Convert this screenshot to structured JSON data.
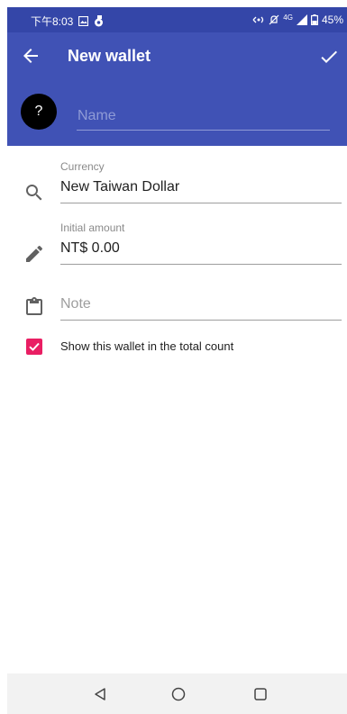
{
  "status_bar": {
    "time": "下午8:03",
    "network_type": "4G",
    "battery": "45%",
    "icons": [
      "gallery-icon",
      "app-notification-icon",
      "hotspot-icon",
      "mute-icon",
      "signal-icon",
      "battery-icon"
    ]
  },
  "toolbar": {
    "title": "New wallet",
    "back_icon": "arrow-left-icon",
    "confirm_icon": "checkmark-icon"
  },
  "header": {
    "avatar_text": "?",
    "name_placeholder": "Name",
    "name_value": ""
  },
  "form": {
    "currency": {
      "label": "Currency",
      "value": "New Taiwan Dollar",
      "icon": "search-icon"
    },
    "initial_amount": {
      "label": "Initial amount",
      "value": "NT$ 0.00",
      "icon": "pencil-icon"
    },
    "note": {
      "placeholder": "Note",
      "value": "",
      "icon": "clipboard-icon"
    },
    "show_in_total": {
      "label": "Show this wallet in the total count",
      "checked": true
    }
  },
  "nav_bar": {
    "icons": [
      "back-triangle-icon",
      "home-circle-icon",
      "recents-square-icon"
    ]
  },
  "colors": {
    "primary": "#4052b5",
    "status_bar": "#3446a8",
    "accent": "#e91e63"
  }
}
